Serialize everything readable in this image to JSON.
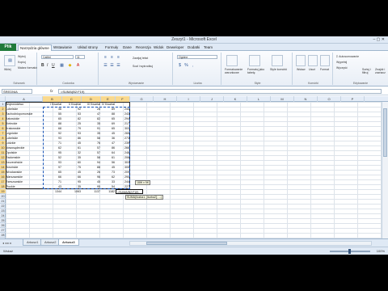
{
  "title_bar": {
    "title": "Zeszyt1 - Microsoft Excel",
    "controls": "‒ ▢ ✕"
  },
  "tabs": {
    "file": "Plik",
    "items": [
      "Narzędzia główne",
      "Wstawianie",
      "Układ strony",
      "Formuły",
      "Dane",
      "Recenzja",
      "Widok",
      "Deweloper",
      "Dodatki",
      "Team"
    ]
  },
  "ribbon": {
    "clipboard": {
      "label": "Schowek",
      "paste": "Wklej",
      "cut": "Wytnij",
      "copy": "Kopiuj",
      "format": "Malarz formatów"
    },
    "font": {
      "label": "Czcionka",
      "name": "Calibri",
      "size": "11"
    },
    "alignment": {
      "label": "Wyrównanie",
      "wrap": "Zawijaj tekst",
      "merge": "Scal i wyśrodkuj"
    },
    "number": {
      "label": "Liczba",
      "format": "Ogólne"
    },
    "styles": {
      "label": "Style",
      "cond": "Formatowanie warunkowe",
      "table": "Formatuj jako tabelę",
      "cell": "Style komórki"
    },
    "cells": {
      "label": "Komórki",
      "insert": "Wstaw",
      "delete": "Usuń",
      "format": "Format"
    },
    "editing": {
      "label": "Edytowanie",
      "autosum": "Autosumowanie",
      "fill": "Wypełnij",
      "clear": "Wyczyść",
      "sort": "Sortuj i filtruj",
      "find": "Znajdź i zaznacz"
    }
  },
  "formula_bar": {
    "namebox": "ŚREDNIA",
    "fx": "fx",
    "formula": "=SUMA(B2:F19)"
  },
  "columns": [
    "A",
    "B",
    "C",
    "D",
    "E",
    "F",
    "G",
    "H",
    "I",
    "J",
    "K",
    "L",
    "M",
    "N",
    "O",
    "P"
  ],
  "rows": [
    "1",
    "2",
    "3",
    "4",
    "5",
    "6",
    "7",
    "8",
    "9",
    "10",
    "11",
    "12",
    "13",
    "14",
    "15",
    "16",
    "17",
    "18",
    "19",
    "20",
    "21",
    "22",
    "23",
    "24",
    "25",
    "26",
    "27",
    "28"
  ],
  "table": {
    "headers": [
      "Województwo",
      "I Kwartał",
      "II Kwartał",
      "III Kwartał",
      "IV Kwartał"
    ],
    "rows": [
      [
        "Lubelskie",
        "36",
        "92",
        "28",
        "89",
        "245"
      ],
      [
        "Zachodniopomorskie",
        "55",
        "53",
        "47",
        "88",
        "243"
      ],
      [
        "Katowickie",
        "65",
        "82",
        "82",
        "65",
        "294"
      ],
      [
        "Kieleckie",
        "88",
        "25",
        "35",
        "69",
        "217"
      ],
      [
        "Krakowskie",
        "68",
        "79",
        "91",
        "65",
        "303"
      ],
      [
        "Legnickie",
        "92",
        "93",
        "35",
        "45",
        "265"
      ],
      [
        "Lubelskie",
        "93",
        "86",
        "58",
        "36",
        "273"
      ],
      [
        "Łódzkie",
        "71",
        "45",
        "76",
        "47",
        "239"
      ],
      [
        "Nowosądeckie",
        "62",
        "61",
        "57",
        "86",
        "266"
      ],
      [
        "Opolskie",
        "95",
        "32",
        "57",
        "64",
        "248"
      ],
      [
        "Radomskie",
        "52",
        "35",
        "58",
        "61",
        "206"
      ],
      [
        "Szczecińskie",
        "93",
        "60",
        "94",
        "56",
        "303"
      ],
      [
        "Toruńskie",
        "97",
        "75",
        "88",
        "45",
        "305"
      ],
      [
        "Wrocławskie",
        "65",
        "45",
        "26",
        "73",
        "209"
      ],
      [
        "Warszawskie",
        "66",
        "66",
        "96",
        "62",
        "290"
      ],
      [
        "Rzeszowskie",
        "71",
        "95",
        "45",
        "33",
        "244"
      ],
      [
        "Płockie",
        "43",
        "35",
        "95",
        "54",
        "227"
      ]
    ],
    "totals": [
      "1344",
      "1063",
      "1137",
      "1182"
    ],
    "active_formula": "=SUMA(B2:F19)"
  },
  "tooltips": {
    "range": "18W x 5K",
    "syntax": "SUMA(liczba1; [liczba2]; ...)"
  },
  "sheets": {
    "nav": "◂ ◂ ▸ ▸",
    "items": [
      "Arkusz1",
      "Arkusz2",
      "Arkusz3"
    ],
    "active_index": 2
  },
  "status": {
    "mode": "Wskaż",
    "zoom": "100%"
  }
}
